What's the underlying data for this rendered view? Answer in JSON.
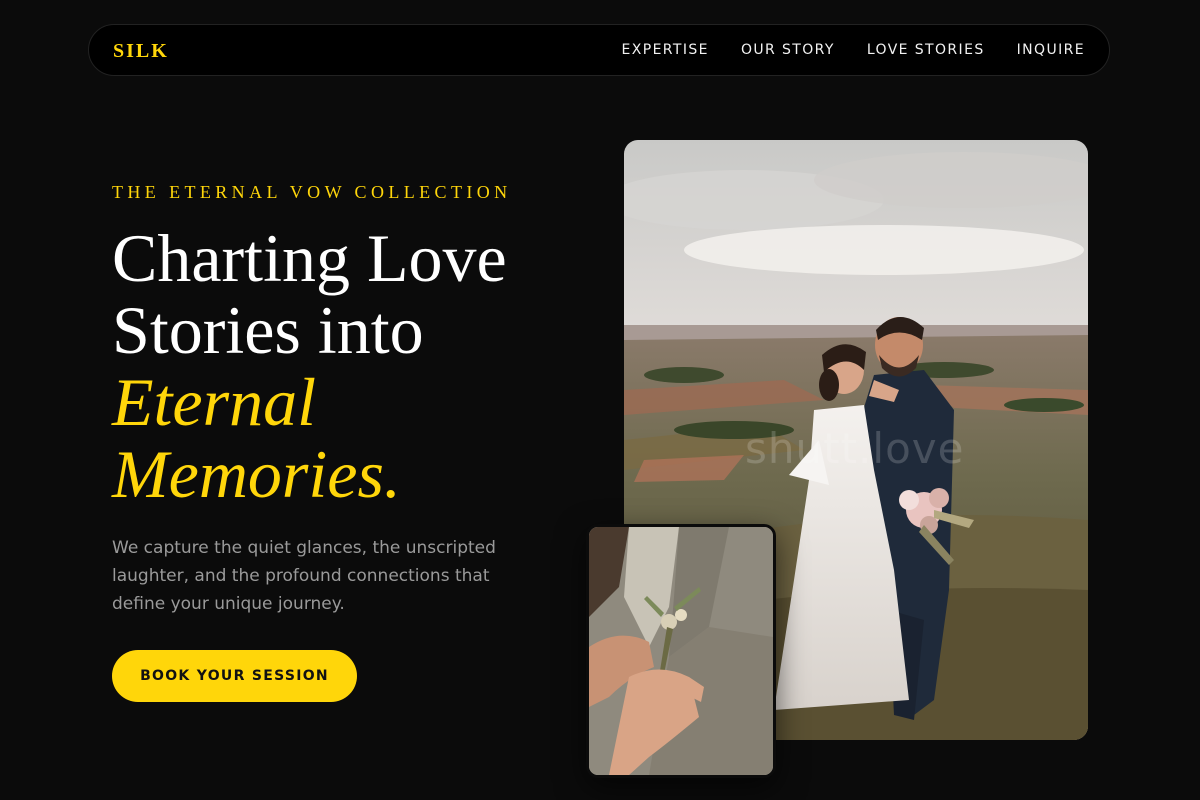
{
  "brand": {
    "logo_text": "SILK"
  },
  "nav": {
    "items": [
      {
        "label": "EXPERTISE"
      },
      {
        "label": "OUR STORY"
      },
      {
        "label": "LOVE STORIES"
      },
      {
        "label": "INQUIRE"
      }
    ]
  },
  "hero": {
    "eyebrow": "THE ETERNAL VOW COLLECTION",
    "headline_line1": "Charting Love",
    "headline_line2": "Stories into",
    "headline_accent1": "Eternal",
    "headline_accent2": "Memories.",
    "description": "We capture the quiet glances, the unscripted laughter, and the profound connections that define your unique journey.",
    "cta_label": "BOOK YOUR SESSION"
  },
  "images": {
    "main": {
      "alt": "Bride and groom embracing on a hillside",
      "icon": "wedding-couple-photo"
    },
    "detail": {
      "alt": "Boutonniere being pinned on a groom's jacket",
      "icon": "boutonniere-photo"
    },
    "watermark_text": "shutt.love"
  },
  "colors": {
    "background": "#0b0b0b",
    "accent": "#ffd60a",
    "text_primary": "#ffffff",
    "text_muted": "#9a9a9a"
  }
}
